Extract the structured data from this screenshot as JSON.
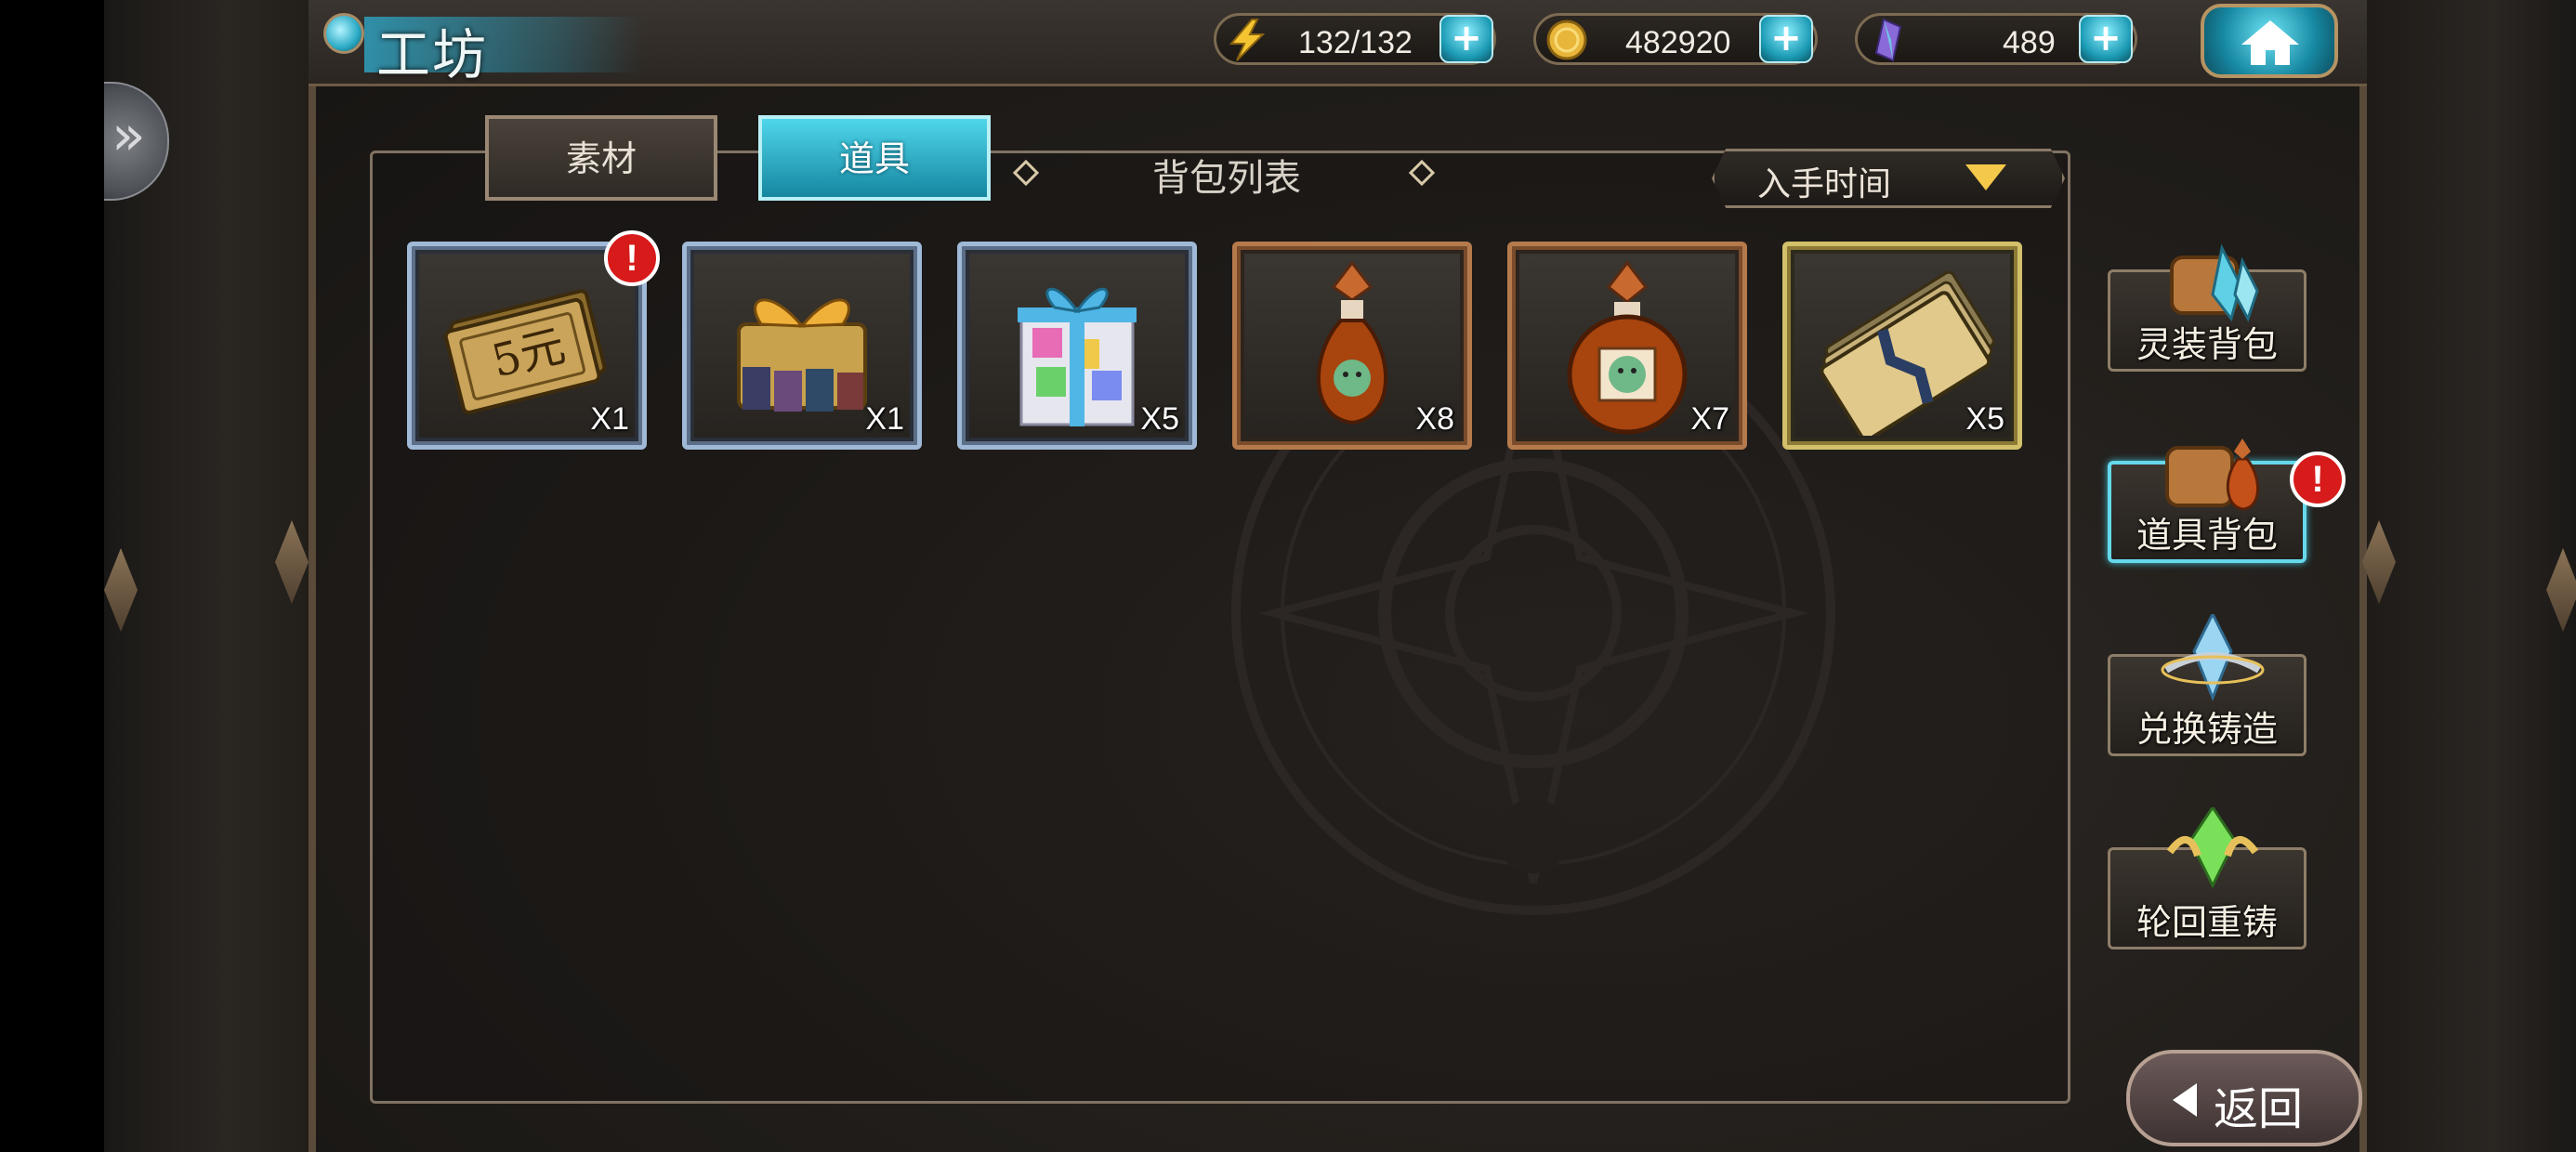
{
  "header": {
    "title": "工坊",
    "stamina": {
      "value": "132/132",
      "icon": "lightning-icon"
    },
    "gold": {
      "value": "482920",
      "icon": "gold-coin-icon"
    },
    "gems": {
      "value": "489",
      "icon": "crystal-gem-icon"
    },
    "home_icon": "home-icon"
  },
  "tabs": [
    {
      "label": "素材",
      "active": false
    },
    {
      "label": "道具",
      "active": true
    }
  ],
  "list_header": "背包列表",
  "sort": {
    "label": "入手时间",
    "icon": "chevron-down-icon"
  },
  "items": [
    {
      "name": "5元",
      "label": "5元",
      "quantity": "X1",
      "alert": "!",
      "frame": "blue"
    },
    {
      "name": "gift-pack-golden",
      "quantity": "X1",
      "frame": "blue"
    },
    {
      "name": "gift-box-blue",
      "quantity": "X5",
      "frame": "blue"
    },
    {
      "name": "potion-bottle-small",
      "quantity": "X8",
      "frame": "bronze"
    },
    {
      "name": "potion-bottle-large",
      "quantity": "X7",
      "frame": "bronze"
    },
    {
      "name": "ticket-stack",
      "quantity": "X5",
      "frame": "gold"
    }
  ],
  "right_nav": [
    {
      "label": "灵装背包",
      "active": false,
      "alert": ""
    },
    {
      "label": "道具背包",
      "active": true,
      "alert": "!"
    },
    {
      "label": "兑换铸造",
      "active": false,
      "alert": ""
    },
    {
      "label": "轮回重铸",
      "active": false,
      "alert": ""
    }
  ],
  "back_label": "返回",
  "colors": {
    "accent": "#1c9bb5",
    "alert": "#d71a1a",
    "sort_arrow": "#f4c84a"
  }
}
